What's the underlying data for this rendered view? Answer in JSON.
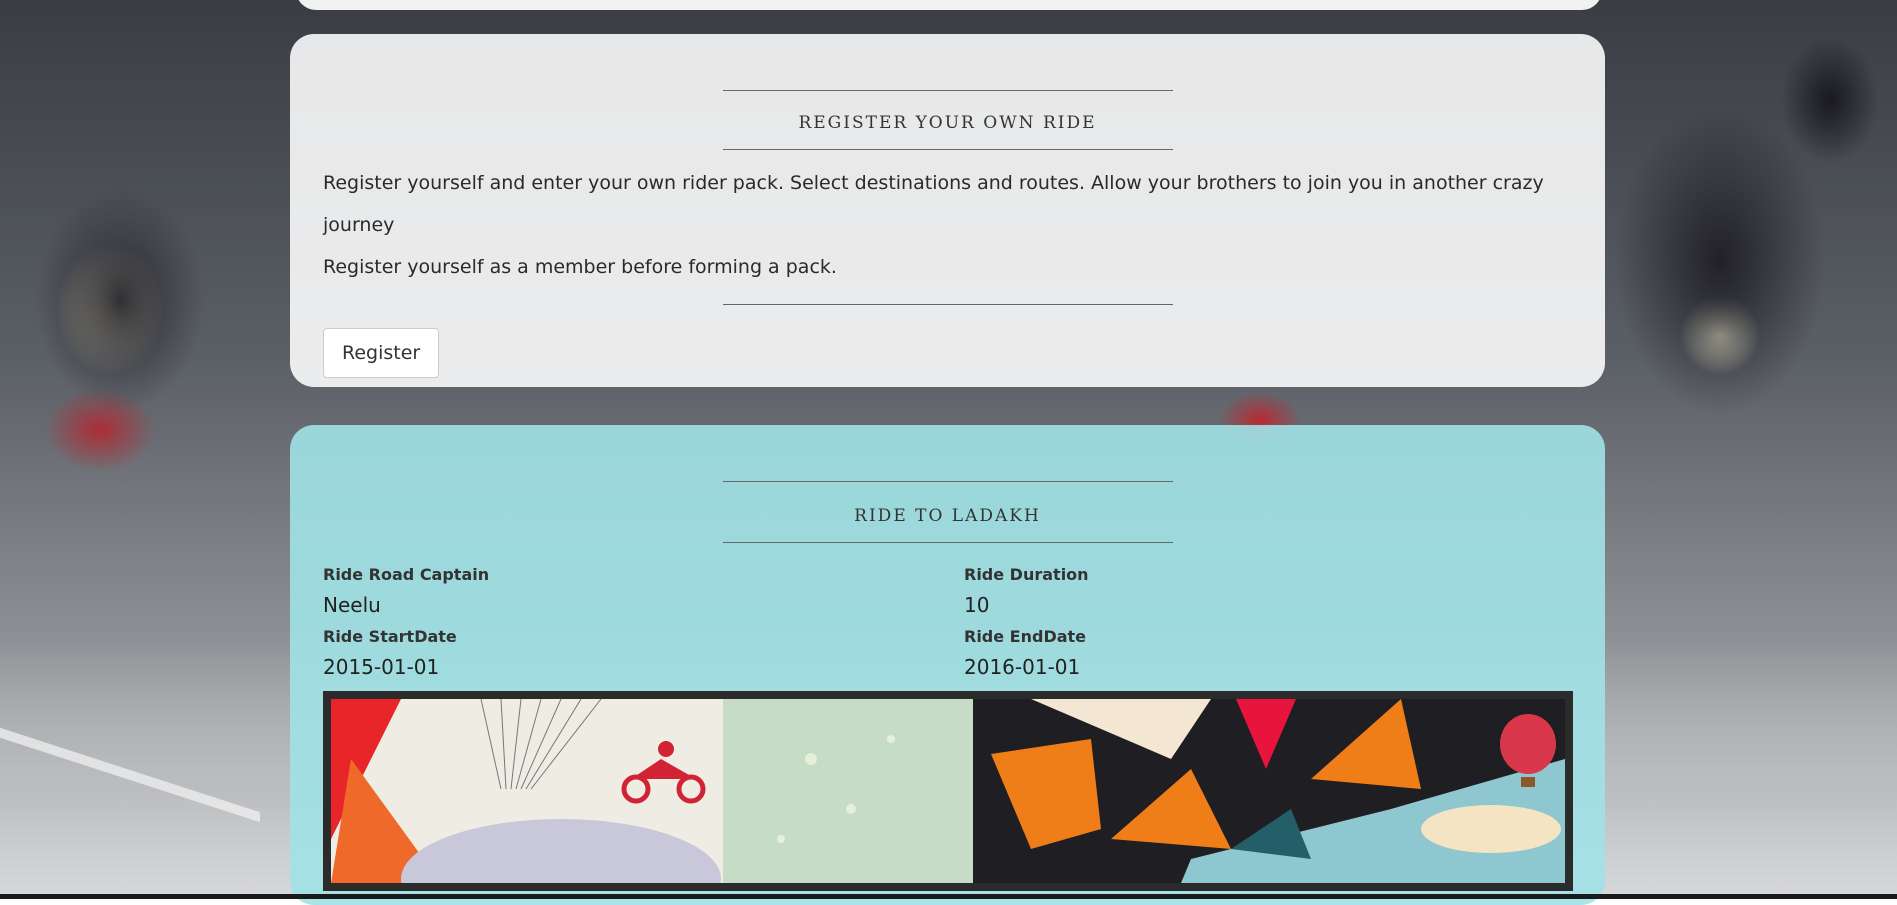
{
  "register_section": {
    "title": "Register your own ride",
    "line1": "Register yourself and enter your own rider pack. Select destinations and routes. Allow your brothers to join you in another crazy journey",
    "line2": "Register yourself as a member before forming a pack.",
    "button_label": "Register"
  },
  "ride": {
    "title": "Ride to Ladakh",
    "captain_label": "Ride Road Captain",
    "captain_value": "Neelu",
    "duration_label": "Ride Duration",
    "duration_value": "10",
    "start_label": "Ride StartDate",
    "start_value": "2015-01-01",
    "end_label": "Ride EndDate",
    "end_value": "2016-01-01"
  },
  "colors": {
    "register_card": "#ffffff",
    "ride_card": "#a0e2e6"
  }
}
